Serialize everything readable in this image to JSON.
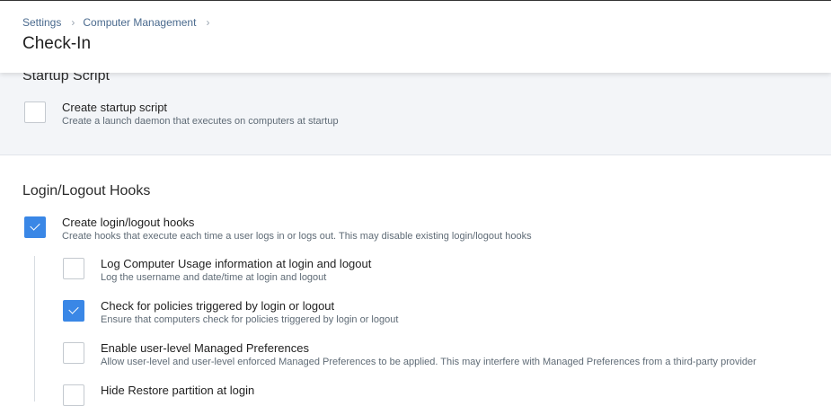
{
  "breadcrumb": {
    "items": [
      "Settings",
      "Computer Management"
    ],
    "separator": "›"
  },
  "page_title": "Check-In",
  "startup_script": {
    "title": "Startup Script",
    "option": {
      "label": "Create startup script",
      "description": "Create a launch daemon that executes on computers at startup",
      "checked": false
    }
  },
  "login_logout_hooks": {
    "title": "Login/Logout Hooks",
    "main_option": {
      "label": "Create login/logout hooks",
      "description": "Create hooks that execute each time a user logs in or logs out. This may disable existing login/logout hooks",
      "checked": true
    },
    "sub_options": [
      {
        "label": "Log Computer Usage information at login and logout",
        "description": "Log the username and date/time at login and logout",
        "checked": false
      },
      {
        "label": "Check for policies triggered by login or logout",
        "description": "Ensure that computers check for policies triggered by login or logout",
        "checked": true
      },
      {
        "label": "Enable user-level Managed Preferences",
        "description": "Allow user-level and user-level enforced Managed Preferences to be applied. This may interfere with Managed Preferences from a third-party provider",
        "checked": false
      },
      {
        "label": "Hide Restore partition at login",
        "description": "",
        "checked": false
      }
    ]
  },
  "colors": {
    "accent": "#3a87e6",
    "link": "#4a6a8e",
    "section_bg": "#f3f5f8"
  }
}
